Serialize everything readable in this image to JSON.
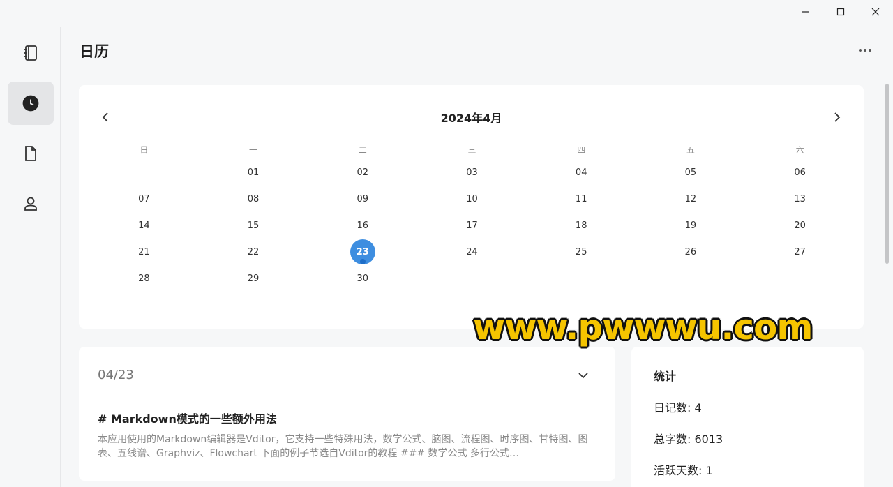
{
  "window": {
    "minimize": "minimize",
    "maximize": "maximize",
    "close": "close"
  },
  "sidebar": {
    "items": [
      {
        "icon": "notebook-icon",
        "active": false
      },
      {
        "icon": "clock-icon",
        "active": true
      },
      {
        "icon": "document-icon",
        "active": false
      },
      {
        "icon": "person-icon",
        "active": false
      }
    ]
  },
  "header": {
    "title": "日历",
    "more_icon": "more-horizontal-icon"
  },
  "calendar": {
    "month_label": "2024年4月",
    "weekdays": [
      "日",
      "一",
      "二",
      "三",
      "四",
      "五",
      "六"
    ],
    "weeks": [
      [
        "",
        "01",
        "02",
        "03",
        "04",
        "05",
        "06"
      ],
      [
        "07",
        "08",
        "09",
        "10",
        "11",
        "12",
        "13"
      ],
      [
        "14",
        "15",
        "16",
        "17",
        "18",
        "19",
        "20"
      ],
      [
        "21",
        "22",
        "23",
        "24",
        "25",
        "26",
        "27"
      ],
      [
        "28",
        "29",
        "30",
        "",
        "",
        "",
        ""
      ]
    ],
    "selected": "23",
    "selected_color": "#3e8ee0"
  },
  "entry": {
    "date": "04/23",
    "title": "# Markdown模式的一些额外用法",
    "excerpt": "本应用使用的Markdown编辑器是Vditor，它支持一些特殊用法，数学公式、脑图、流程图、时序图、甘特图、图表、五线谱、Graphviz、Flowchart 下面的例子节选自Vditor的教程 ### 数学公式 多行公式…"
  },
  "stats": {
    "title": "统计",
    "diary_count": "日记数: 4",
    "word_count": "总字数: 6013",
    "active_days": "活跃天数: 1"
  },
  "watermark": "www.pwwwu.com"
}
